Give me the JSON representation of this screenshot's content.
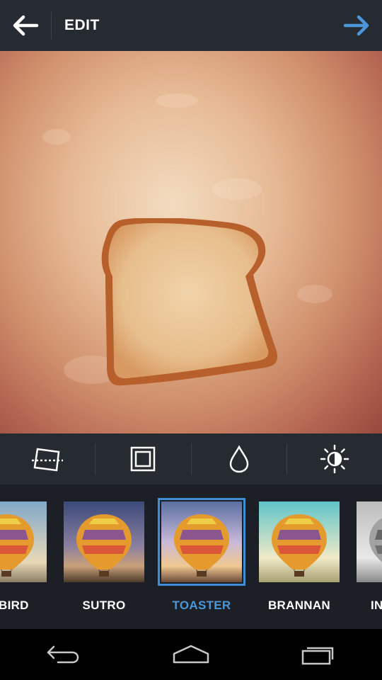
{
  "header": {
    "title": "EDIT",
    "back_icon": "arrow-left-icon",
    "next_icon": "arrow-right-icon",
    "accent_color": "#4b97d9"
  },
  "tools": [
    {
      "name": "straighten",
      "icon": "straighten-icon"
    },
    {
      "name": "frame",
      "icon": "frame-icon"
    },
    {
      "name": "tilt-shift",
      "icon": "drop-icon"
    },
    {
      "name": "lux",
      "icon": "lux-sun-icon"
    }
  ],
  "filters": [
    {
      "label": "LYBIRD",
      "selected": false
    },
    {
      "label": "SUTRO",
      "selected": false
    },
    {
      "label": "TOASTER",
      "selected": true
    },
    {
      "label": "BRANNAN",
      "selected": false
    },
    {
      "label": "IN",
      "selected": false
    }
  ],
  "navbar": {
    "back_icon": "back-icon",
    "home_icon": "home-icon",
    "recents_icon": "recents-icon"
  }
}
